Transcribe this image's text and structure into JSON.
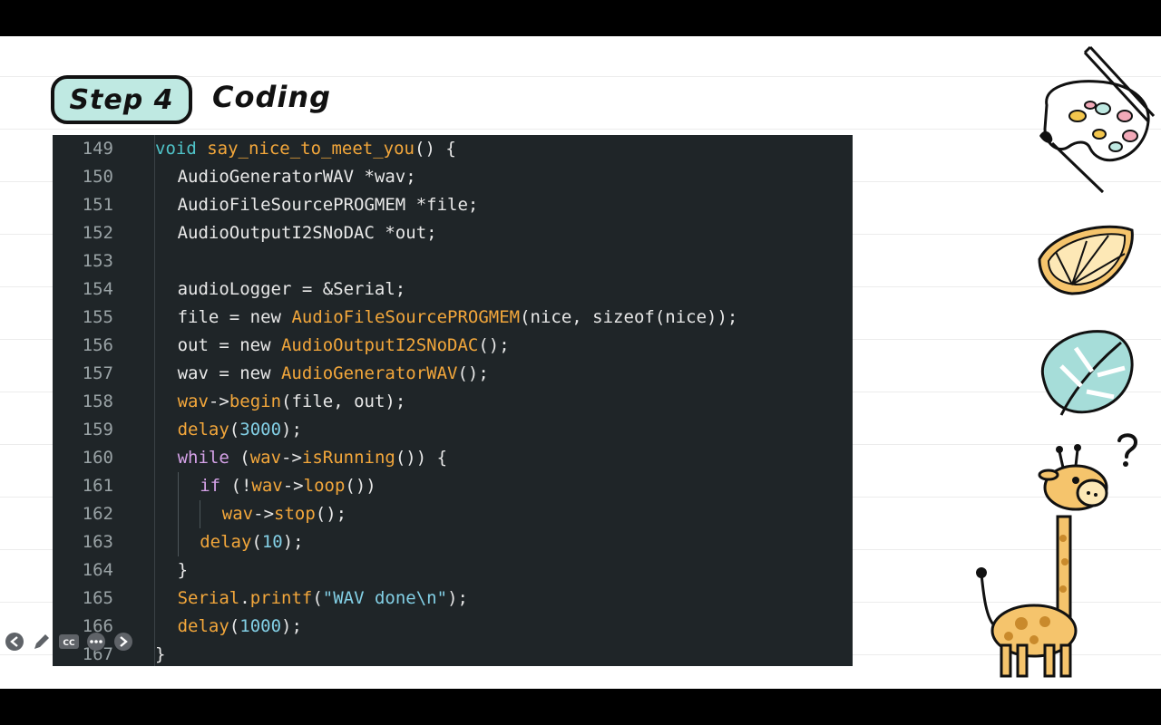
{
  "slide": {
    "step_label": "Step 4",
    "title": "Coding"
  },
  "code": {
    "lines": [
      {
        "num": "149",
        "indent": 0,
        "tokens": [
          [
            "type",
            "void"
          ],
          [
            "txt",
            " "
          ],
          [
            "fn",
            "say_nice_to_meet_you"
          ],
          [
            "txt",
            "() {"
          ]
        ]
      },
      {
        "num": "150",
        "indent": 1,
        "tokens": [
          [
            "txt",
            "AudioGeneratorWAV *wav;"
          ]
        ]
      },
      {
        "num": "151",
        "indent": 1,
        "tokens": [
          [
            "txt",
            "AudioFileSourcePROGMEM *file;"
          ]
        ]
      },
      {
        "num": "152",
        "indent": 1,
        "tokens": [
          [
            "txt",
            "AudioOutputI2SNoDAC *out;"
          ]
        ]
      },
      {
        "num": "153",
        "indent": 1,
        "tokens": []
      },
      {
        "num": "154",
        "indent": 1,
        "tokens": [
          [
            "txt",
            "audioLogger = &Serial;"
          ]
        ]
      },
      {
        "num": "155",
        "indent": 1,
        "tokens": [
          [
            "txt",
            "file = new "
          ],
          [
            "fn",
            "AudioFileSourcePROGMEM"
          ],
          [
            "txt",
            "(nice, sizeof(nice));"
          ]
        ]
      },
      {
        "num": "156",
        "indent": 1,
        "tokens": [
          [
            "txt",
            "out = new "
          ],
          [
            "fn",
            "AudioOutputI2SNoDAC"
          ],
          [
            "txt",
            "();"
          ]
        ]
      },
      {
        "num": "157",
        "indent": 1,
        "tokens": [
          [
            "txt",
            "wav = new "
          ],
          [
            "fn",
            "AudioGeneratorWAV"
          ],
          [
            "txt",
            "();"
          ]
        ]
      },
      {
        "num": "158",
        "indent": 1,
        "tokens": [
          [
            "fn",
            "wav"
          ],
          [
            "txt",
            "->"
          ],
          [
            "fn",
            "begin"
          ],
          [
            "txt",
            "(file, out);"
          ]
        ]
      },
      {
        "num": "159",
        "indent": 1,
        "tokens": [
          [
            "fn",
            "delay"
          ],
          [
            "txt",
            "("
          ],
          [
            "num",
            "3000"
          ],
          [
            "txt",
            ");"
          ]
        ]
      },
      {
        "num": "160",
        "indent": 1,
        "tokens": [
          [
            "kw",
            "while"
          ],
          [
            "txt",
            " ("
          ],
          [
            "fn",
            "wav"
          ],
          [
            "txt",
            "->"
          ],
          [
            "fn",
            "isRunning"
          ],
          [
            "txt",
            "()) {"
          ]
        ]
      },
      {
        "num": "161",
        "indent": 2,
        "tokens": [
          [
            "kw",
            "if"
          ],
          [
            "txt",
            " (!"
          ],
          [
            "fn",
            "wav"
          ],
          [
            "txt",
            "->"
          ],
          [
            "fn",
            "loop"
          ],
          [
            "txt",
            "())"
          ]
        ]
      },
      {
        "num": "162",
        "indent": 3,
        "tokens": [
          [
            "fn",
            "wav"
          ],
          [
            "txt",
            "->"
          ],
          [
            "fn",
            "stop"
          ],
          [
            "txt",
            "();"
          ]
        ]
      },
      {
        "num": "163",
        "indent": 2,
        "tokens": [
          [
            "fn",
            "delay"
          ],
          [
            "txt",
            "("
          ],
          [
            "num",
            "10"
          ],
          [
            "txt",
            ");"
          ]
        ]
      },
      {
        "num": "164",
        "indent": 1,
        "tokens": [
          [
            "txt",
            "}"
          ]
        ]
      },
      {
        "num": "165",
        "indent": 1,
        "tokens": [
          [
            "fn",
            "Serial"
          ],
          [
            "txt",
            "."
          ],
          [
            "fn",
            "printf"
          ],
          [
            "txt",
            "("
          ],
          [
            "str",
            "\"WAV done\\n\""
          ],
          [
            "txt",
            ");"
          ]
        ]
      },
      {
        "num": "166",
        "indent": 1,
        "tokens": [
          [
            "fn",
            "delay"
          ],
          [
            "txt",
            "("
          ],
          [
            "num",
            "1000"
          ],
          [
            "txt",
            ");"
          ]
        ]
      },
      {
        "num": "167",
        "indent": 0,
        "tokens": [
          [
            "txt",
            "}"
          ]
        ]
      }
    ]
  },
  "decorations": [
    "paint-palette-icon",
    "orange-slice-icon",
    "monstera-leaf-icon",
    "giraffe-icon",
    "question-mark-icon"
  ],
  "player_controls": [
    {
      "name": "previous-slide-button",
      "icon": "arrow-left-icon"
    },
    {
      "name": "pen-tool-button",
      "icon": "pencil-icon"
    },
    {
      "name": "captions-button",
      "icon": "cc-icon"
    },
    {
      "name": "more-options-button",
      "icon": "ellipsis-icon"
    },
    {
      "name": "next-slide-button",
      "icon": "arrow-right-icon"
    }
  ],
  "colors": {
    "badge_fill": "#bfe9e2",
    "code_bg": "#1f2528",
    "keyword": "#d5a2e8",
    "type": "#4fc3c8",
    "function": "#f3a73b",
    "number": "#83d0e6"
  }
}
